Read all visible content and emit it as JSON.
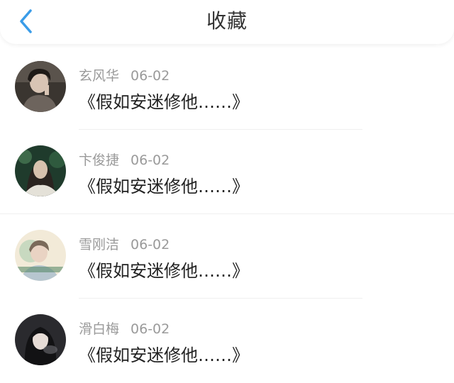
{
  "header": {
    "title": "收藏",
    "back_icon": "chevron-left-icon",
    "accent": "#3a9ce8"
  },
  "items": [
    {
      "name": "玄风华",
      "date": "06-02",
      "content": "《假如安迷修他……》",
      "avatar_icon": "user-avatar-icon"
    },
    {
      "name": "卞俊捷",
      "date": "06-02",
      "content": "《假如安迷修他……》",
      "avatar_icon": "user-avatar-icon"
    },
    {
      "name": "雪刚洁",
      "date": "06-02",
      "content": "《假如安迷修他……》",
      "avatar_icon": "user-avatar-icon"
    },
    {
      "name": "滑白梅",
      "date": "06-02",
      "content": "《假如安迷修他……》",
      "avatar_icon": "user-avatar-icon"
    }
  ]
}
